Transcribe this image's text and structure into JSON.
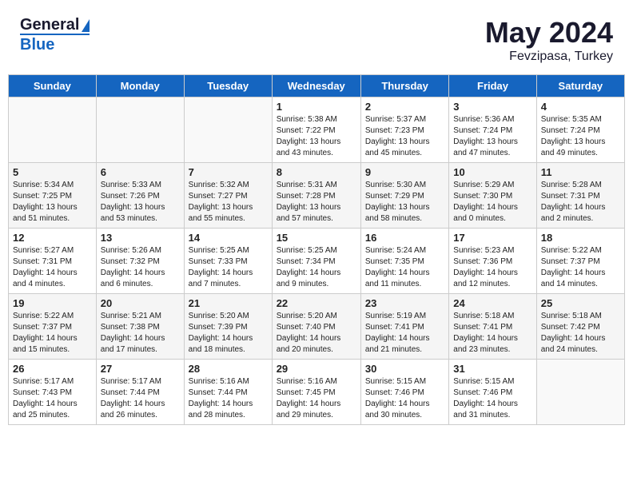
{
  "header": {
    "logo_line1": "General",
    "logo_line2": "Blue",
    "month": "May 2024",
    "location": "Fevzipasa, Turkey"
  },
  "weekdays": [
    "Sunday",
    "Monday",
    "Tuesday",
    "Wednesday",
    "Thursday",
    "Friday",
    "Saturday"
  ],
  "weeks": [
    [
      {
        "day": "",
        "info": ""
      },
      {
        "day": "",
        "info": ""
      },
      {
        "day": "",
        "info": ""
      },
      {
        "day": "1",
        "info": "Sunrise: 5:38 AM\nSunset: 7:22 PM\nDaylight: 13 hours\nand 43 minutes."
      },
      {
        "day": "2",
        "info": "Sunrise: 5:37 AM\nSunset: 7:23 PM\nDaylight: 13 hours\nand 45 minutes."
      },
      {
        "day": "3",
        "info": "Sunrise: 5:36 AM\nSunset: 7:24 PM\nDaylight: 13 hours\nand 47 minutes."
      },
      {
        "day": "4",
        "info": "Sunrise: 5:35 AM\nSunset: 7:24 PM\nDaylight: 13 hours\nand 49 minutes."
      }
    ],
    [
      {
        "day": "5",
        "info": "Sunrise: 5:34 AM\nSunset: 7:25 PM\nDaylight: 13 hours\nand 51 minutes."
      },
      {
        "day": "6",
        "info": "Sunrise: 5:33 AM\nSunset: 7:26 PM\nDaylight: 13 hours\nand 53 minutes."
      },
      {
        "day": "7",
        "info": "Sunrise: 5:32 AM\nSunset: 7:27 PM\nDaylight: 13 hours\nand 55 minutes."
      },
      {
        "day": "8",
        "info": "Sunrise: 5:31 AM\nSunset: 7:28 PM\nDaylight: 13 hours\nand 57 minutes."
      },
      {
        "day": "9",
        "info": "Sunrise: 5:30 AM\nSunset: 7:29 PM\nDaylight: 13 hours\nand 58 minutes."
      },
      {
        "day": "10",
        "info": "Sunrise: 5:29 AM\nSunset: 7:30 PM\nDaylight: 14 hours\nand 0 minutes."
      },
      {
        "day": "11",
        "info": "Sunrise: 5:28 AM\nSunset: 7:31 PM\nDaylight: 14 hours\nand 2 minutes."
      }
    ],
    [
      {
        "day": "12",
        "info": "Sunrise: 5:27 AM\nSunset: 7:31 PM\nDaylight: 14 hours\nand 4 minutes."
      },
      {
        "day": "13",
        "info": "Sunrise: 5:26 AM\nSunset: 7:32 PM\nDaylight: 14 hours\nand 6 minutes."
      },
      {
        "day": "14",
        "info": "Sunrise: 5:25 AM\nSunset: 7:33 PM\nDaylight: 14 hours\nand 7 minutes."
      },
      {
        "day": "15",
        "info": "Sunrise: 5:25 AM\nSunset: 7:34 PM\nDaylight: 14 hours\nand 9 minutes."
      },
      {
        "day": "16",
        "info": "Sunrise: 5:24 AM\nSunset: 7:35 PM\nDaylight: 14 hours\nand 11 minutes."
      },
      {
        "day": "17",
        "info": "Sunrise: 5:23 AM\nSunset: 7:36 PM\nDaylight: 14 hours\nand 12 minutes."
      },
      {
        "day": "18",
        "info": "Sunrise: 5:22 AM\nSunset: 7:37 PM\nDaylight: 14 hours\nand 14 minutes."
      }
    ],
    [
      {
        "day": "19",
        "info": "Sunrise: 5:22 AM\nSunset: 7:37 PM\nDaylight: 14 hours\nand 15 minutes."
      },
      {
        "day": "20",
        "info": "Sunrise: 5:21 AM\nSunset: 7:38 PM\nDaylight: 14 hours\nand 17 minutes."
      },
      {
        "day": "21",
        "info": "Sunrise: 5:20 AM\nSunset: 7:39 PM\nDaylight: 14 hours\nand 18 minutes."
      },
      {
        "day": "22",
        "info": "Sunrise: 5:20 AM\nSunset: 7:40 PM\nDaylight: 14 hours\nand 20 minutes."
      },
      {
        "day": "23",
        "info": "Sunrise: 5:19 AM\nSunset: 7:41 PM\nDaylight: 14 hours\nand 21 minutes."
      },
      {
        "day": "24",
        "info": "Sunrise: 5:18 AM\nSunset: 7:41 PM\nDaylight: 14 hours\nand 23 minutes."
      },
      {
        "day": "25",
        "info": "Sunrise: 5:18 AM\nSunset: 7:42 PM\nDaylight: 14 hours\nand 24 minutes."
      }
    ],
    [
      {
        "day": "26",
        "info": "Sunrise: 5:17 AM\nSunset: 7:43 PM\nDaylight: 14 hours\nand 25 minutes."
      },
      {
        "day": "27",
        "info": "Sunrise: 5:17 AM\nSunset: 7:44 PM\nDaylight: 14 hours\nand 26 minutes."
      },
      {
        "day": "28",
        "info": "Sunrise: 5:16 AM\nSunset: 7:44 PM\nDaylight: 14 hours\nand 28 minutes."
      },
      {
        "day": "29",
        "info": "Sunrise: 5:16 AM\nSunset: 7:45 PM\nDaylight: 14 hours\nand 29 minutes."
      },
      {
        "day": "30",
        "info": "Sunrise: 5:15 AM\nSunset: 7:46 PM\nDaylight: 14 hours\nand 30 minutes."
      },
      {
        "day": "31",
        "info": "Sunrise: 5:15 AM\nSunset: 7:46 PM\nDaylight: 14 hours\nand 31 minutes."
      },
      {
        "day": "",
        "info": ""
      }
    ]
  ]
}
